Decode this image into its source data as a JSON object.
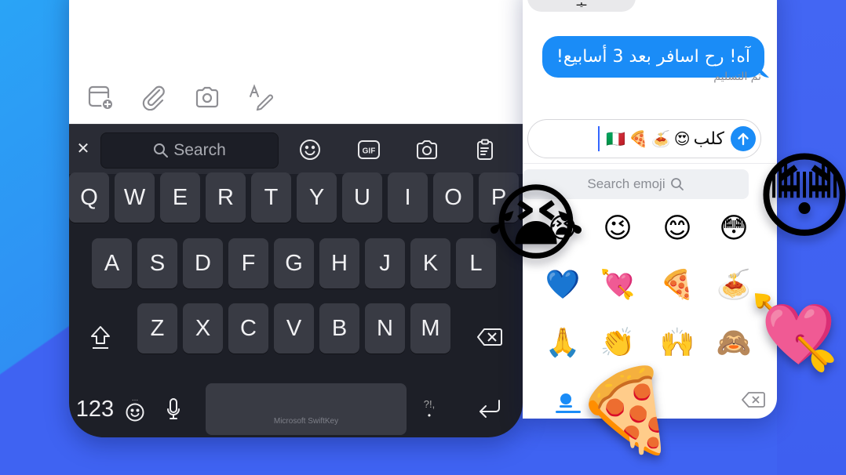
{
  "compose": {
    "toolbar": [
      {
        "icon": "calendar-add-icon",
        "label": "Add event"
      },
      {
        "icon": "paperclip-icon",
        "label": "Attach"
      },
      {
        "icon": "camera-icon",
        "label": "Camera"
      },
      {
        "icon": "handwriting-icon",
        "label": "Draw"
      }
    ]
  },
  "keyboard": {
    "toolbar": {
      "close_glyph": "✕",
      "search_label": "Search",
      "tools": [
        "emoji-icon",
        "gif-icon",
        "camera-icon",
        "clipboard-icon"
      ],
      "gif_label": "GIF"
    },
    "rows": [
      [
        "Q",
        "W",
        "E",
        "R",
        "T",
        "Y",
        "U",
        "I",
        "O",
        "P"
      ],
      [
        "A",
        "S",
        "D",
        "F",
        "G",
        "H",
        "J",
        "K",
        "L"
      ],
      [
        "Z",
        "X",
        "C",
        "V",
        "B",
        "N",
        "M"
      ]
    ],
    "numbers_label": "123",
    "emoji_dots": "...",
    "punct_label": "?!,",
    "punct_dot": "•",
    "space_label": "Microsoft SwiftKey"
  },
  "messages": {
    "received_partial": "ـيـ",
    "sent_message": "آه! رح اسافر بعد 3 أسابيع!",
    "delivered_status": "تم التسليم",
    "input_text": "كلب",
    "input_emojis": [
      "😍",
      "🍝",
      "🍕",
      "🇮🇹"
    ],
    "emoji_search_placeholder": "Search emoji",
    "accent_color": "#1a8cf7"
  },
  "emoji_keyboard": {
    "grid": [
      [
        "😭",
        "😉",
        "😊",
        "😳"
      ],
      [
        "💙",
        "💘",
        "🍕",
        "🍝"
      ],
      [
        "🙏",
        "👏",
        "🙌",
        "🙈"
      ]
    ],
    "tab_icon": "recent-emoji-icon",
    "delete_icon": "backspace-icon"
  },
  "floating_emojis": {
    "crying": "😭",
    "flushed": "😳",
    "heart_arrow": "💘",
    "pizza": "🍕"
  }
}
